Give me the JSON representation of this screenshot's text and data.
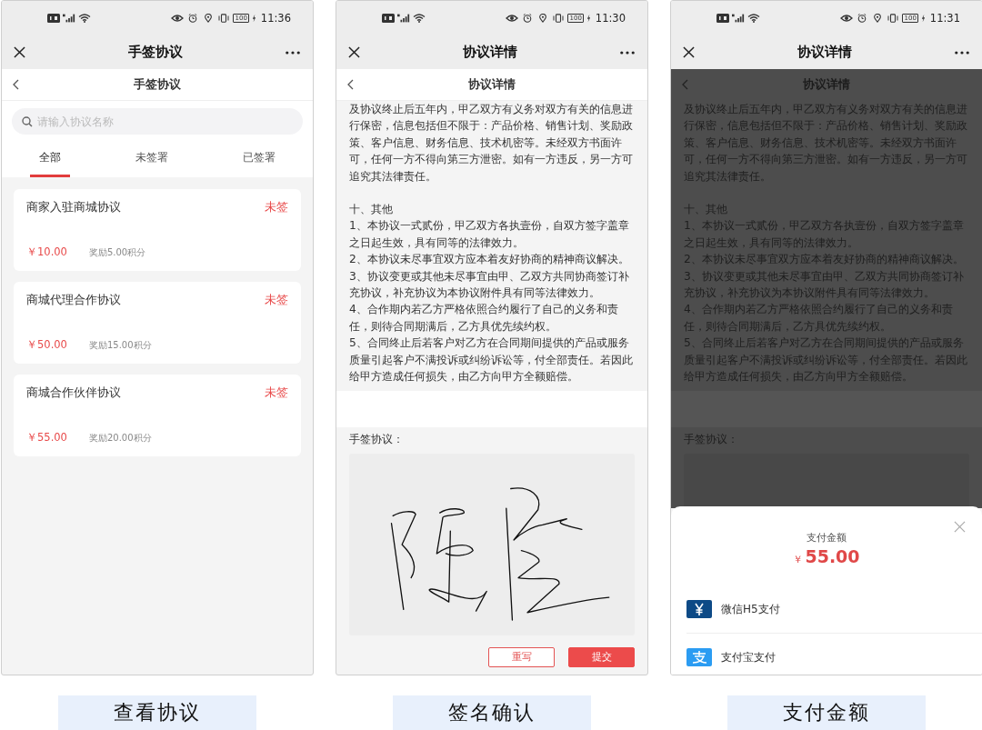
{
  "screens": [
    {
      "kind": "list",
      "dimmed": false,
      "status_bar": {
        "battery": "100",
        "time": "11:36"
      },
      "title": "手签协议",
      "nav_title": "手签协议",
      "search": {
        "placeholder": "请输入协议名称"
      },
      "tabs": [
        {
          "label": "全部",
          "selected": true
        },
        {
          "label": "未签署",
          "selected": false
        },
        {
          "label": "已签署",
          "selected": false
        }
      ],
      "agreements": [
        {
          "name": "商家入驻商城协议",
          "status": "未签",
          "price": "￥10.00",
          "reward": "奖励5.00积分"
        },
        {
          "name": "商城代理合作协议",
          "status": "未签",
          "price": "￥50.00",
          "reward": "奖励15.00积分"
        },
        {
          "name": "商城合作伙伴协议",
          "status": "未签",
          "price": "￥55.00",
          "reward": "奖励20.00积分"
        }
      ],
      "caption": "查看协议"
    },
    {
      "kind": "sign",
      "dimmed": false,
      "status_bar": {
        "battery": "100",
        "time": "11:30"
      },
      "title": "协议详情",
      "nav_title": "协议详情",
      "paragraphs": [
        "及协议终止后五年内，甲乙双方有义务对双方有关的信息进行保密，信息包括但不限于：产品价格、销售计划、奖励政策、客户信息、财务信息、技术机密等。未经双方书面许可，任何一方不得向第三方泄密。如有一方违反，另一方可追究其法律责任。",
        "十、其他",
        "1、本协议一式贰份，甲乙双方各执壹份，自双方签字盖章之日起生效，具有同等的法律效力。",
        "2、本协议未尽事宜双方应本着友好协商的精神商议解决。",
        "3、协议变更或其他未尽事宜由甲、乙双方共同协商签订补充协议，补充协议为本协议附件具有同等法律效力。",
        "4、合作期内若乙方严格依照合约履行了自己的义务和责任，则待合同期满后，乙方具优先续约权。",
        "5、合同终止后若客户对乙方在合同期间提供的产品或服务质量引起客户不满投诉或纠纷诉讼等，付全部责任。若因此给甲方造成任何损失，由乙方向甲方全额赔偿。"
      ],
      "sign_label": "手签协议：",
      "buttons": [
        {
          "label": "重写",
          "kind": "secondary"
        },
        {
          "label": "提交",
          "kind": "primary"
        }
      ],
      "caption": "签名确认"
    },
    {
      "kind": "pay",
      "dimmed": true,
      "status_bar": {
        "battery": "100",
        "time": "11:31"
      },
      "title": "协议详情",
      "nav_title": "协议详情",
      "paragraphs": [
        "及协议终止后五年内，甲乙双方有义务对双方有关的信息进行保密，信息包括但不限于：产品价格、销售计划、奖励政策、客户信息、财务信息、技术机密等。未经双方书面许可，任何一方不得向第三方泄密。如有一方违反，另一方可追究其法律责任。",
        "十、其他",
        "1、本协议一式贰份，甲乙双方各执壹份，自双方签字盖章之日起生效，具有同等的法律效力。",
        "2、本协议未尽事宜双方应本着友好协商的精神商议解决。",
        "3、协议变更或其他未尽事宜由甲、乙双方共同协商签订补充协议，补充协议为本协议附件具有同等法律效力。",
        "4、合作期内若乙方严格依照合约履行了自己的义务和责任，则待合同期满后，乙方具优先续约权。",
        "5、合同终止后若客户对乙方在合同期间提供的产品或服务质量引起客户不满投诉或纠纷诉讼等，付全部责任。若因此给甲方造成任何损失，由乙方向甲方全额赔偿。"
      ],
      "sign_label": "手签协议：",
      "payment": {
        "title": "支付金额",
        "currency": "￥",
        "amount": "55.00",
        "methods": [
          {
            "label": "微信H5支付",
            "kind": "yuan"
          },
          {
            "label": "支付宝支付",
            "kind": "wallet"
          }
        ]
      },
      "caption": "支付金额"
    }
  ]
}
